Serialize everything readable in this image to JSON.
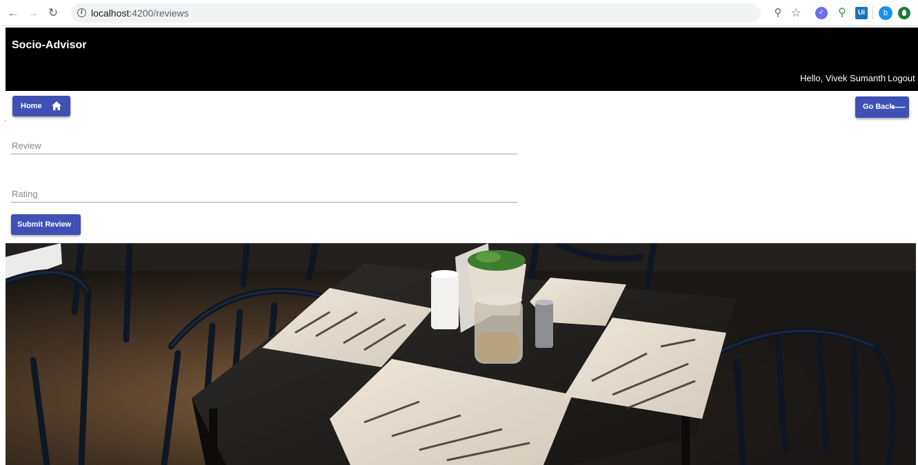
{
  "browser": {
    "url_host": "localhost:",
    "url_path": "4200/reviews",
    "profile_initial": "b",
    "extension_ui_label": "Ui"
  },
  "header": {
    "brand": "Socio-Advisor",
    "greeting": "Hello, Vivek Sumanth",
    "logout_label": "Logout",
    "background_color": "#000000"
  },
  "toolbar": {
    "home_label": "Home",
    "go_back_label": "Go Back"
  },
  "form": {
    "review_placeholder": "Review",
    "rating_placeholder": "Rating",
    "submit_label": "Submit Review"
  },
  "colors": {
    "primary": "#3f51b5",
    "header_bg": "#000000"
  },
  "hero": {
    "icon": "restaurant-photo"
  }
}
